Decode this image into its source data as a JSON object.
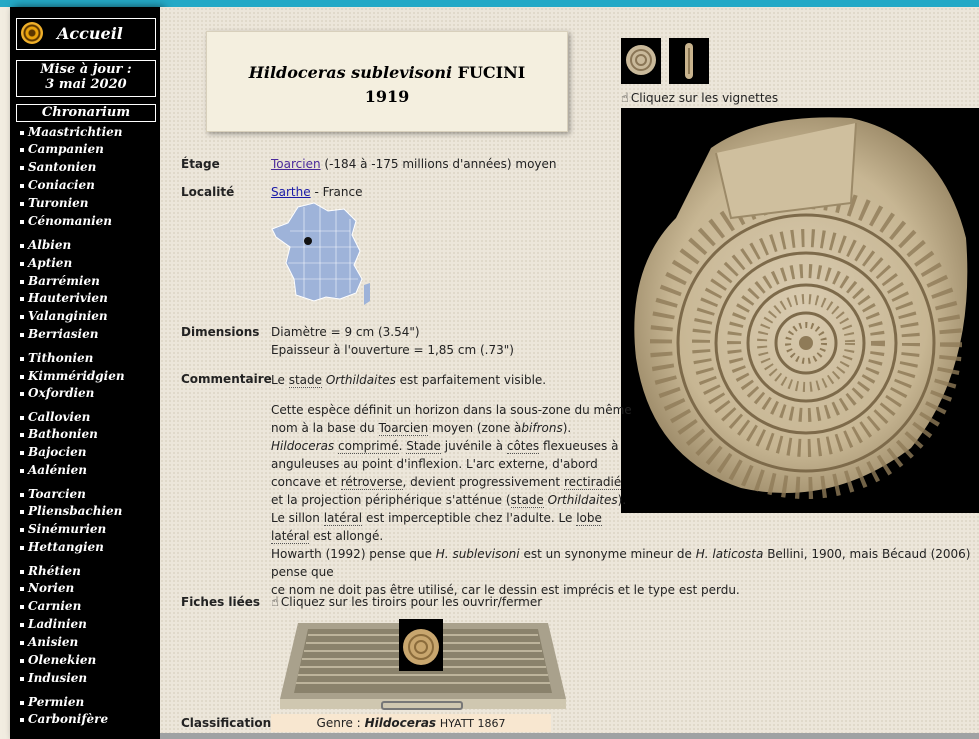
{
  "sidebar": {
    "home_label": "Accueil",
    "update_line1": "Mise à jour :",
    "update_line2": "3 mai 2020",
    "chronarium_label": "Chronarium",
    "stages": [
      "Maastrichtien",
      "Campanien",
      "Santonien",
      "Coniacien",
      "Turonien",
      "Cénomanien",
      "Albien",
      "Aptien",
      "Barrémien",
      "Hauterivien",
      "Valanginien",
      "Berriasien",
      "Tithonien",
      "Kimméridgien",
      "Oxfordien",
      "Callovien",
      "Bathonien",
      "Bajocien",
      "Aalénien",
      "Toarcien",
      "Pliensbachien",
      "Sinémurien",
      "Hettangien",
      "Rhétien",
      "Norien",
      "Carnien",
      "Ladinien",
      "Anisien",
      "Olenekien",
      "Indusien",
      "Permien",
      "Carbonifère"
    ]
  },
  "title": {
    "genus_species": "Hildoceras sublevisoni",
    "author": "FUCINI",
    "year": "1919"
  },
  "etage": {
    "label": "Étage",
    "link": "Toarcien",
    "rest": "(-184 à -175 millions d'années) moyen"
  },
  "localite": {
    "label": "Localité",
    "link": "Sarthe",
    "rest": "- France"
  },
  "dimensions": {
    "label": "Dimensions",
    "line1": "Diamètre = 9 cm (3.54\")",
    "line2": "Epaisseur à l'ouverture = 1,85 cm (.73\")"
  },
  "commentaire": {
    "label": "Commentaire",
    "c1_a": "Le",
    "c1_stade": "stade",
    "c1_b": "Orthildaites",
    "c1_c": "est parfaitement visible.",
    "p2_l1": "Cette espèce définit un horizon dans la sous-zone du même",
    "p2_l2_a": "nom à la base du",
    "p2_l2_link": "Toarcien",
    "p2_l2_b": "moyen (zone à",
    "p2_l2_c": "bifrons",
    "p2_l2_d": ").",
    "p2_l3_a": "Hildoceras",
    "p2_l3_b": "comprimé",
    "p2_l3_c": ".",
    "p2_l3_d": "Stade",
    "p2_l3_e": "juvénile à",
    "p2_l3_f": "côtes",
    "p2_l3_g": "flexueuses à",
    "p2_l4": "anguleuses au point d'inflexion. L'arc externe, d'abord",
    "p2_l5_a": "concave et",
    "p2_l5_b": "rétroverse",
    "p2_l5_c": ", devient progressivement",
    "p2_l5_d": "rectiradié",
    "p2_l6_a": "et la projection périphérique s'atténue (",
    "p2_l6_b": "stade",
    "p2_l6_c": "Orthildaites",
    "p2_l6_d": ").",
    "p2_l7_a": "Le sillon",
    "p2_l7_b": "latéral",
    "p2_l7_c": "est imperceptible chez l'adulte. Le",
    "p2_l7_d": "lobe",
    "p2_l8_a": "latéral",
    "p2_l8_b": "est allongé.",
    "p3_l1_a": "Howarth (1992) pense que",
    "p3_l1_b": "H. sublevisoni",
    "p3_l1_c": "est un synonyme mineur de",
    "p3_l1_d": "H. laticosta",
    "p3_l1_e": "Bellini, 1900, mais Bécaud (2006) pense que",
    "p3_l2": "ce nom ne doit pas être utilisé, car le dessin est imprécis et le type est perdu."
  },
  "fiches": {
    "label": "Fiches liées",
    "hint": "Cliquez sur les tiroirs pour les ouvrir/fermer"
  },
  "vignettes_hint": "Cliquez sur les vignettes",
  "classification": {
    "label": "Classification",
    "genre_prefix": "Genre :",
    "genre_name": "Hildoceras",
    "genre_author": "HYATT 1867"
  },
  "colors": {
    "accent_top": "#24a9c6",
    "sidebar_bg": "#000000",
    "link_visited": "#4a2a9a",
    "link": "#1a1aa8"
  }
}
